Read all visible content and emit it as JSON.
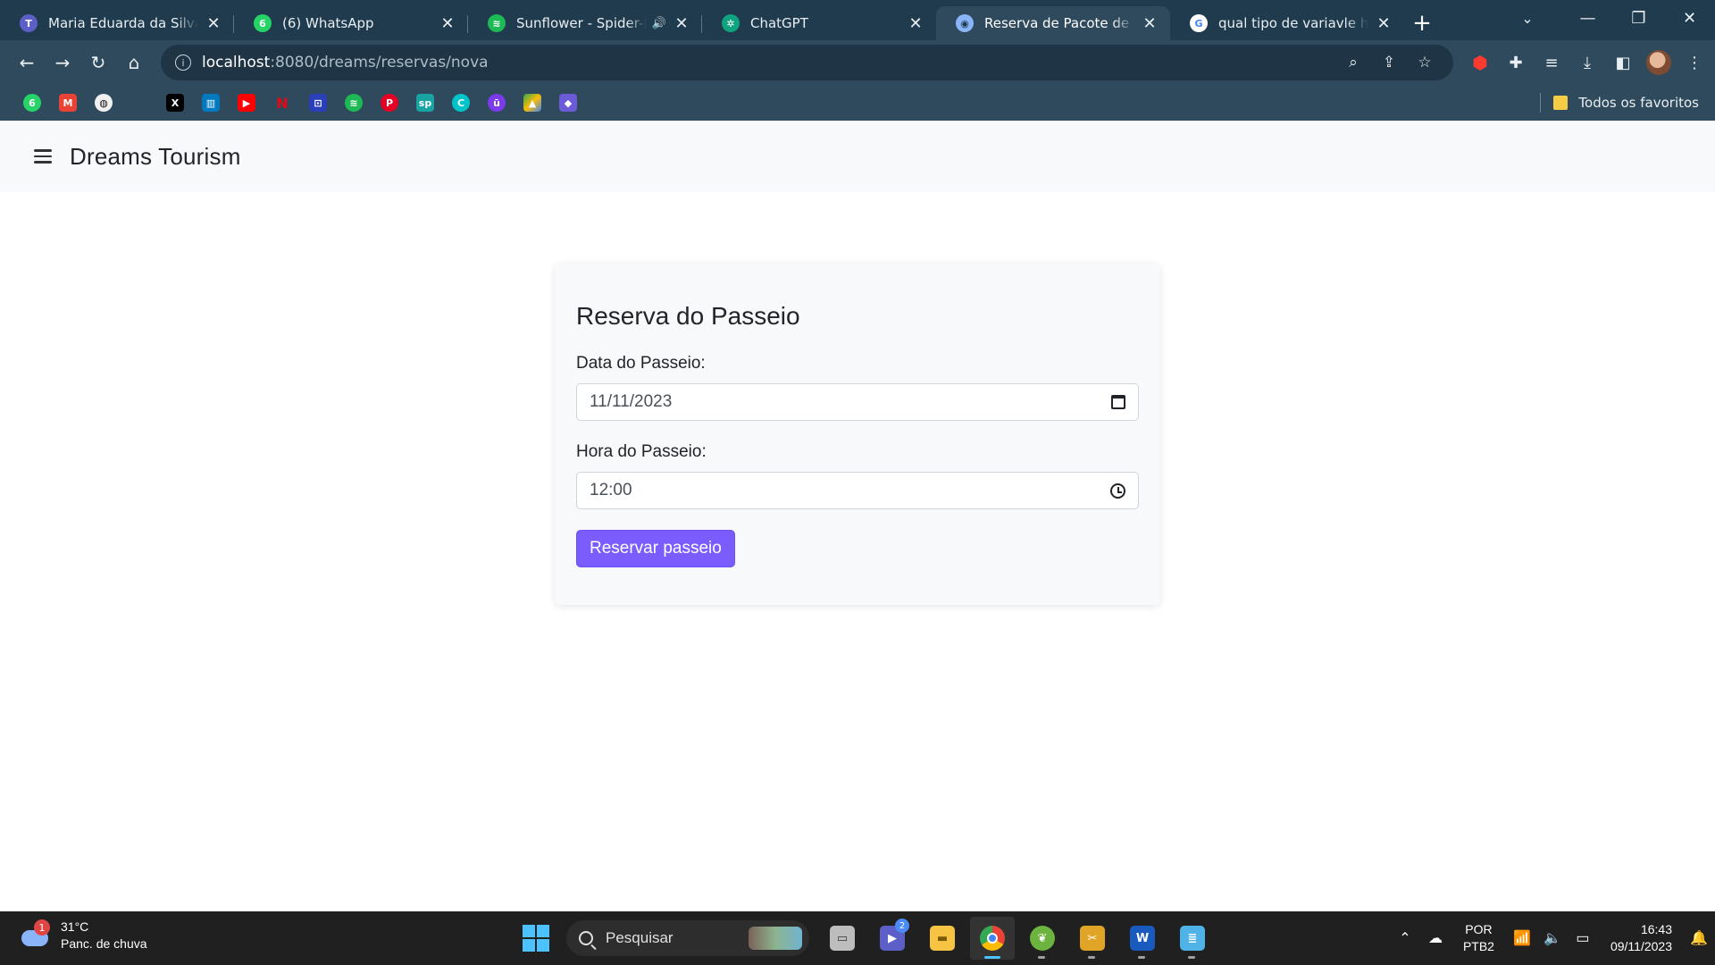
{
  "browser": {
    "tabs": [
      {
        "title": "Maria Eduarda da Silva Dias",
        "favicon": "teams-icon",
        "color": "#5b5fc7",
        "glyph": "T"
      },
      {
        "title": "(6) WhatsApp",
        "favicon": "whatsapp-icon",
        "color": "#25d366",
        "glyph": "6"
      },
      {
        "title": "Sunflower - Spider-Man",
        "favicon": "spotify-icon",
        "color": "#1db954",
        "glyph": "≋"
      },
      {
        "title": "ChatGPT",
        "favicon": "chatgpt-icon",
        "color": "#10a37f",
        "glyph": "✲"
      },
      {
        "title": "Reserva de Pacote de Viagem",
        "favicon": "globe-icon",
        "color": "#8ab4f8",
        "glyph": "◉"
      },
      {
        "title": "qual tipo de variavle hora de",
        "favicon": "google-icon",
        "color": "#ffffff",
        "glyph": "G"
      }
    ],
    "active_tab": 4,
    "url_host": "localhost",
    "url_path": ":8080/dreams/reservas/nova",
    "bookmarks_folder": "Todos os favoritos"
  },
  "page": {
    "brand": "Dreams Tourism",
    "form": {
      "title": "Reserva do Passeio",
      "date_label": "Data do Passeio:",
      "date_value": "11/11/2023",
      "time_label": "Hora do Passeio:",
      "time_value": "12:00",
      "submit_label": "Reservar passeio"
    },
    "accent_color": "#7b5cff"
  },
  "taskbar": {
    "weather_temp": "31°C",
    "weather_desc": "Panc. de chuva",
    "weather_badge": "1",
    "search_placeholder": "Pesquisar",
    "chat_badge": "2",
    "lang_line1": "POR",
    "lang_line2": "PTB2",
    "time": "16:43",
    "date": "09/11/2023"
  }
}
